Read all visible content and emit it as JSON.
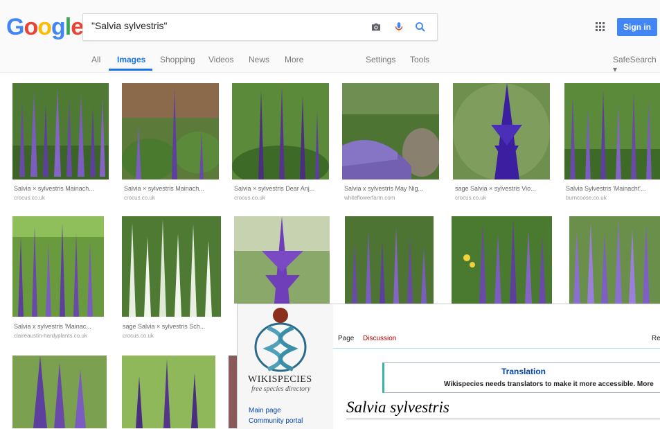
{
  "header": {
    "logo": {
      "letters": [
        "G",
        "o",
        "o",
        "g",
        "l",
        "e"
      ],
      "colors": [
        "#4285f4",
        "#ea4335",
        "#fbbc05",
        "#4285f4",
        "#34a853",
        "#ea4335"
      ]
    },
    "search": {
      "value": "\"Salvia sylvestris\""
    },
    "icons": [
      "camera-icon",
      "microphone-icon",
      "search-icon",
      "apps-icon"
    ],
    "signin_label": "Sign in",
    "accent": "#4285f4"
  },
  "tabs": {
    "all": "All",
    "images": "Images",
    "shopping": "Shopping",
    "videos": "Videos",
    "news": "News",
    "more": "More",
    "settings": "Settings",
    "tools": "Tools",
    "safesearch": "SafeSearch ▾"
  },
  "results": [
    {
      "caption": "Salvia × sylvestris Mainach...",
      "source": "crocus.co.uk"
    },
    {
      "caption": "Salvia × sylvestris Mainach...",
      "source": "crocus.co.uk"
    },
    {
      "caption": "Salvia × sylvestris Dear Anj...",
      "source": "crocus.co.uk"
    },
    {
      "caption": "Salvia x sylvestris May Nig...",
      "source": "whiteflowerfarm.com"
    },
    {
      "caption": "sage Salvia × sylvestris Vio...",
      "source": "crocus.co.uk"
    },
    {
      "caption": "Salvia Sylvestris 'Mainacht'...",
      "source": "burncoose.co.uk"
    },
    {
      "caption": "Salvia x sylvestris 'Mainac...",
      "source": "claireaustin-hardyplants.co.uk"
    },
    {
      "caption": "sage Salvia × sylvestris Sch...",
      "source": "crocus.co.uk"
    }
  ],
  "wikispecies": {
    "logo_title": "WIKISPECIES",
    "logo_subtitle": "free species directory",
    "sidebar_links": [
      "Main page",
      "Community portal"
    ],
    "tabs": {
      "page": "Page",
      "discussion": "Discussion",
      "read_partial": "Re"
    },
    "translation_title": "Translation",
    "translation_text": "Wikispecies needs translators to make it more accessible. More",
    "heading": "Salvia sylvestris"
  }
}
